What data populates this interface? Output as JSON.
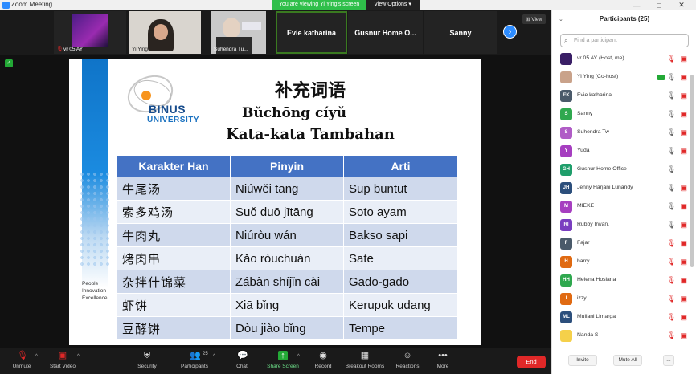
{
  "window": {
    "title": "Zoom Meeting",
    "controls": [
      "—",
      "□",
      "✕"
    ]
  },
  "share_banner": {
    "viewing_text": "You are viewing Yi Ying's screen",
    "view_options_label": "View Options ▾"
  },
  "video_strip": {
    "tiles": [
      {
        "name": "vr 05 AY",
        "kind": "video",
        "bg": "#3a1f66"
      },
      {
        "name": "Yi Ying",
        "kind": "video",
        "bg": "#d9d5cf"
      },
      {
        "name": "Suhendra Tu...",
        "kind": "video",
        "bg": "#c9c9c9"
      },
      {
        "name": "Evie katharina",
        "kind": "name"
      },
      {
        "name": "Gusnur Home O...",
        "kind": "name"
      },
      {
        "name": "Sanny",
        "kind": "name"
      }
    ],
    "view_label": "⊞ View",
    "next_arrow": "›"
  },
  "slide": {
    "logo_text": "BINUS",
    "logo_subtext": "UNIVERSITY",
    "title_chinese": "补充词语",
    "title_pinyin": "Bǔchōng cíyǔ",
    "title_indonesian": "Kata-kata Tambahan",
    "table": {
      "headers": [
        "Karakter Han",
        "Pinyin",
        "Arti"
      ],
      "rows": [
        [
          "牛尾汤",
          "Niúwěi tāng",
          "Sup buntut"
        ],
        [
          "索多鸡汤",
          "Suǒ duō jītāng",
          "Soto ayam"
        ],
        [
          "牛肉丸",
          "Niúròu wán",
          "Bakso sapi"
        ],
        [
          "烤肉串",
          "Kǎo ròuchuàn",
          "Sate"
        ],
        [
          "杂拌什锦菜",
          "Zábàn shíjǐn cài",
          "Gado-gado"
        ],
        [
          "虾饼",
          "Xiā bǐng",
          "Kerupuk udang"
        ],
        [
          "豆酵饼",
          "Dòu jiào bǐng",
          "Tempe"
        ]
      ]
    },
    "tagline": [
      "People",
      "Innovation",
      "Excellence"
    ]
  },
  "toolbar": {
    "unmute": "Unmute",
    "start_video": "Start Video",
    "security": "Security",
    "participants": "Participants",
    "participants_count": "25",
    "chat": "Chat",
    "share_screen": "Share Screen",
    "record": "Record",
    "breakout_rooms": "Breakout Rooms",
    "reactions": "Reactions",
    "more": "More",
    "end": "End"
  },
  "participants_panel": {
    "title": "Participants (25)",
    "search_placeholder": "Find a participant",
    "rows": [
      {
        "initials": "",
        "name": "vr 05 AY (Host, me)",
        "color": "#3a1f66",
        "mic": "muted",
        "cam": "off"
      },
      {
        "initials": "",
        "name": "Yi Ying (Co-host)",
        "color": "#c9a28a",
        "mic": "on",
        "cam": "off",
        "sharing": true
      },
      {
        "initials": "EK",
        "name": "Evie katharina",
        "color": "#4a5a6a",
        "mic": "on",
        "cam": "off"
      },
      {
        "initials": "S",
        "name": "Sanny",
        "color": "#2fa84f",
        "mic": "on",
        "cam": "off"
      },
      {
        "initials": "S",
        "name": "Suhendra Tw",
        "color": "#b05cc6",
        "mic": "on",
        "cam": "off"
      },
      {
        "initials": "Y",
        "name": "Yuda",
        "color": "#a63ec0",
        "mic": "on",
        "cam": "off"
      },
      {
        "initials": "GH",
        "name": "Gusnur Home Office",
        "color": "#1f9e6b",
        "mic": "on",
        "cam": ""
      },
      {
        "initials": "JH",
        "name": "Jenny Harjani Lunandy",
        "color": "#2c4f7c",
        "mic": "on",
        "cam": "off"
      },
      {
        "initials": "M",
        "name": "MIEKE",
        "color": "#a63ec0",
        "mic": "on",
        "cam": "off"
      },
      {
        "initials": "RI",
        "name": "Rubby Irwan.",
        "color": "#7a3ec0",
        "mic": "on",
        "cam": "off"
      },
      {
        "initials": "F",
        "name": "Fajar",
        "color": "#4a5a6a",
        "mic": "muted",
        "cam": "off"
      },
      {
        "initials": "H",
        "name": "harry",
        "color": "#e06a12",
        "mic": "muted",
        "cam": "off"
      },
      {
        "initials": "HH",
        "name": "Helena Hosiana",
        "color": "#2fa84f",
        "mic": "muted",
        "cam": "off"
      },
      {
        "initials": "I",
        "name": "izzy",
        "color": "#e06a12",
        "mic": "muted",
        "cam": "off"
      },
      {
        "initials": "ML",
        "name": "Muliani Limarga",
        "color": "#2c4f7c",
        "mic": "muted",
        "cam": "off"
      },
      {
        "initials": "",
        "name": "Nanda S",
        "color": "#f5d04a",
        "mic": "muted",
        "cam": "off"
      }
    ],
    "invite_label": "Invite",
    "mute_all_label": "Mute All",
    "more_label": "..."
  }
}
